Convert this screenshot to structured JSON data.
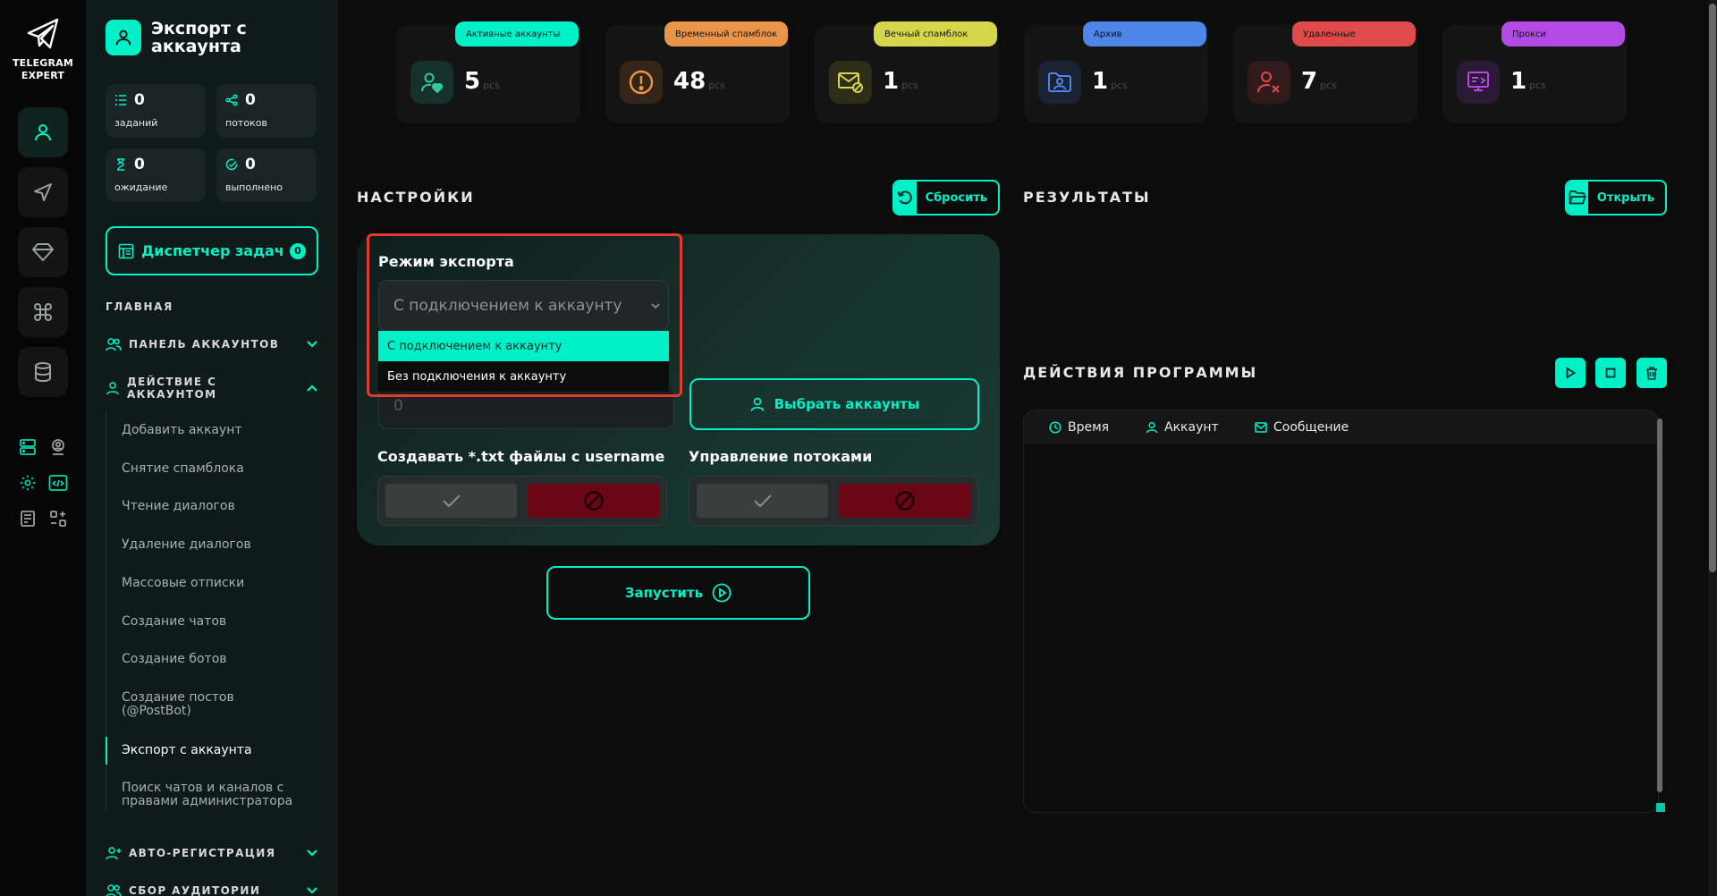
{
  "app": {
    "logo_line1": "TELEGRAM",
    "logo_line2": "EXPERT",
    "accent": "#00f0c8"
  },
  "rail": {
    "items": [
      {
        "icon": "user-icon",
        "active": true
      },
      {
        "icon": "send-icon",
        "active": false
      },
      {
        "icon": "diamond-icon",
        "active": false
      },
      {
        "icon": "command-icon",
        "active": false
      },
      {
        "icon": "database-icon",
        "active": false
      }
    ],
    "mini": [
      "server-icon",
      "user-pin-icon",
      "settings-icon",
      "code-icon",
      "document-icon",
      "apps-icon"
    ]
  },
  "sidebar": {
    "title": "Экспорт с аккаунта",
    "stats": [
      {
        "value": "0",
        "label": "заданий",
        "icon": "list-icon"
      },
      {
        "value": "0",
        "label": "потоков",
        "icon": "share-icon"
      },
      {
        "value": "0",
        "label": "ожидание",
        "icon": "hourglass-icon"
      },
      {
        "value": "0",
        "label": "выполнено",
        "icon": "check-circle-icon"
      }
    ],
    "dispatcher": {
      "label": "Диспетчер задач",
      "badge": "0"
    },
    "section": "ГЛАВНАЯ",
    "groups": [
      {
        "label": "ПАНЕЛЬ АККАУНТОВ",
        "icon": "users-icon",
        "expanded": false
      },
      {
        "label": "ДЕЙСТВИЕ С АККАУНТОМ",
        "icon": "user-icon",
        "expanded": true
      },
      {
        "label": "АВТО-РЕГИСТРАЦИЯ",
        "icon": "user-plus-icon",
        "expanded": false
      },
      {
        "label": "СБОР АУДИТОРИИ",
        "icon": "users-icon",
        "expanded": false
      }
    ],
    "items": [
      "Добавить аккаунт",
      "Снятие спамблока",
      "Чтение диалогов",
      "Удаление диалогов",
      "Массовые отписки",
      "Создание чатов",
      "Создание ботов",
      "Создание постов (@PostBot)",
      "Экспорт с аккаунта",
      "Поиск чатов и каналов с правами администратора"
    ],
    "active_item": "Экспорт с аккаунта"
  },
  "account_cards": [
    {
      "tag": "Активные аккаунты",
      "value": "5",
      "unit": "pcs",
      "tag_color": "#00f0c8",
      "icon": "user-heart-icon",
      "icon_color": "#2fc9a2"
    },
    {
      "tag": "Временный спамблок",
      "value": "48",
      "unit": "pcs",
      "tag_color": "#e8954a",
      "icon": "alert-circle-icon",
      "icon_color": "#e8954a"
    },
    {
      "tag": "Вечный спамблок",
      "value": "1",
      "unit": "pcs",
      "tag_color": "#d6d64a",
      "icon": "mail-block-icon",
      "icon_color": "#d6d64a"
    },
    {
      "tag": "Архив",
      "value": "1",
      "unit": "pcs",
      "tag_color": "#4d86e6",
      "icon": "folder-user-icon",
      "icon_color": "#4d86e6"
    },
    {
      "tag": "Удаленные",
      "value": "7",
      "unit": "pcs",
      "tag_color": "#e04a4a",
      "icon": "user-x-icon",
      "icon_color": "#e04a4a"
    },
    {
      "tag": "Прокси",
      "value": "1",
      "unit": "pcs",
      "tag_color": "#b44ae6",
      "icon": "proxy-icon",
      "icon_color": "#b44ae6"
    }
  ],
  "settings": {
    "title": "НАСТРОЙКИ",
    "reset_label": "Сбросить",
    "export_mode": {
      "label": "Режим экспорта",
      "value": "С подключением к аккаунту",
      "options": [
        "С подключением к аккаунту",
        "Без подключения к аккаунту"
      ],
      "selected_index": 0
    },
    "count_value": "0",
    "select_accounts_label": "Выбрать аккаунты",
    "txt_files_label": "Создавать *.txt файлы с username",
    "threads_label": "Управление потоками",
    "run_label": "Запустить"
  },
  "results": {
    "title": "РЕЗУЛЬТАТЫ",
    "open_label": "Открыть"
  },
  "actions": {
    "title": "ДЕЙСТВИЯ ПРОГРАММЫ",
    "columns": [
      {
        "label": "Время",
        "icon": "clock-icon"
      },
      {
        "label": "Аккаунт",
        "icon": "user-icon"
      },
      {
        "label": "Сообщение",
        "icon": "mail-icon"
      }
    ]
  }
}
